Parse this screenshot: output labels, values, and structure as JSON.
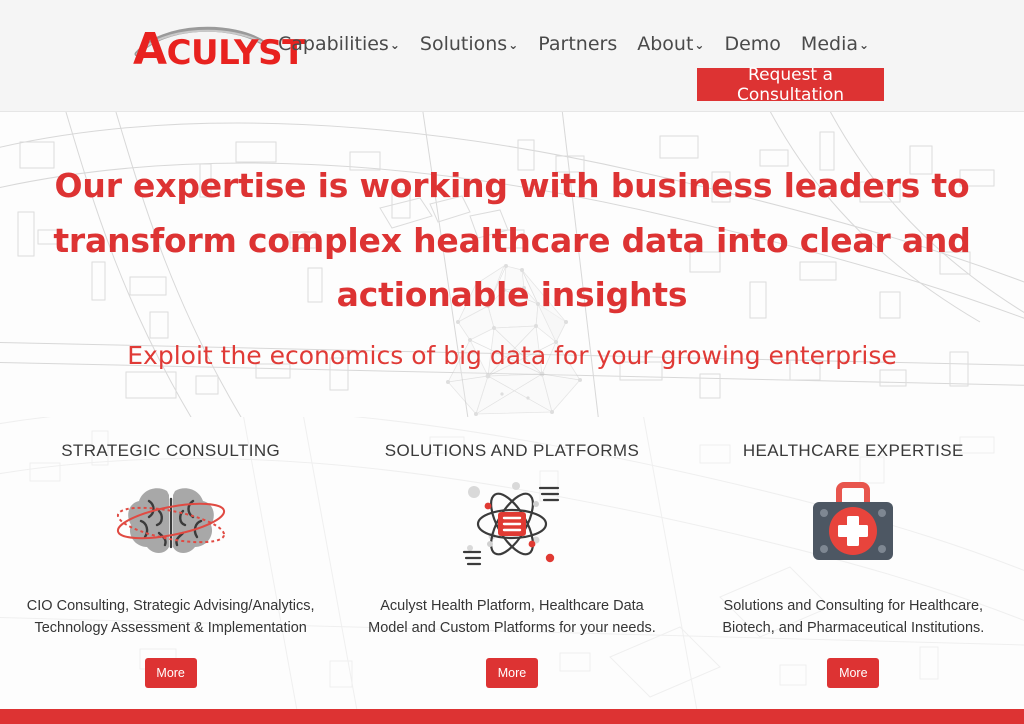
{
  "brand": {
    "logo_text": "CULYST",
    "logo_initial": "A",
    "logo_full": "ACULYST",
    "logo_color": "#e8221f",
    "arc_color": "#8c8c8c"
  },
  "header": {
    "background": "#f5f5f5",
    "nav": [
      {
        "label": "Capabilities",
        "has_dropdown": true,
        "caret": "⌄"
      },
      {
        "label": "Solutions",
        "has_dropdown": true,
        "caret": "⌄"
      },
      {
        "label": "Partners",
        "has_dropdown": false,
        "caret": ""
      },
      {
        "label": "About",
        "has_dropdown": true,
        "caret": "⌄"
      },
      {
        "label": "Demo",
        "has_dropdown": false,
        "caret": ""
      },
      {
        "label": "Media",
        "has_dropdown": true,
        "caret": "⌄"
      }
    ],
    "cta": {
      "label": "Request a Consultation",
      "color": "#dd3333"
    }
  },
  "hero": {
    "headline": "Our expertise is working with business leaders to transform complex healthcare data into clear and actionable insights",
    "subheadline": "Exploit the economics of big data for your growing enterprise",
    "text_color": "#dd3333"
  },
  "features": [
    {
      "title": "STRATEGIC CONSULTING",
      "icon": "brain-icon",
      "description": "CIO Consulting, Strategic Advising/Analytics, Technology Assessment & Implementation",
      "button_label": "More"
    },
    {
      "title": "SOLUTIONS AND PLATFORMS",
      "icon": "atom-icon",
      "description": "Aculyst Health Platform, Healthcare Data Model and Custom Platforms for your needs.",
      "button_label": "More"
    },
    {
      "title": "HEALTHCARE EXPERTISE",
      "icon": "medical-kit-icon",
      "description": "Solutions and Consulting for Healthcare, Biotech, and Pharmaceutical Institutions.",
      "button_label": "More"
    }
  ],
  "footer": {
    "bar_color": "#dd3333"
  }
}
